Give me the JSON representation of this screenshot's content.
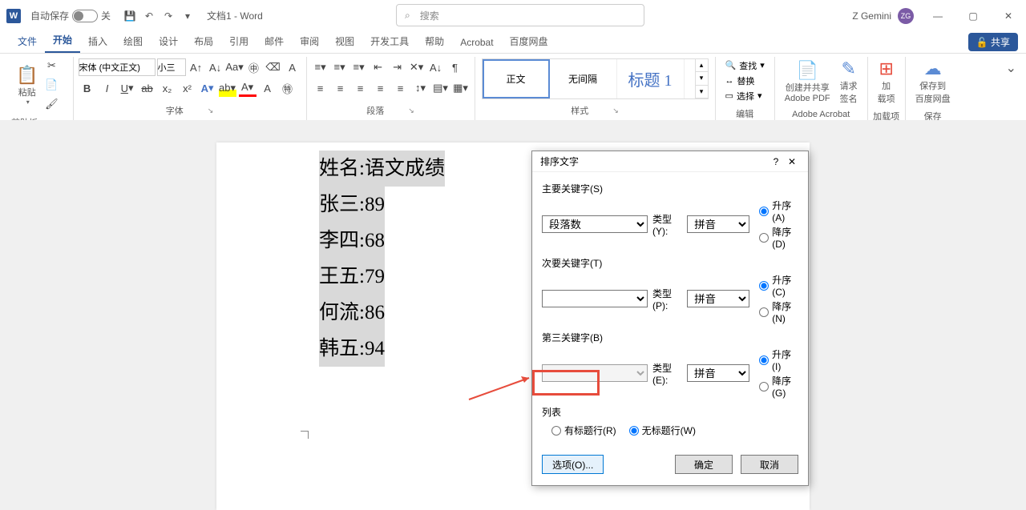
{
  "titlebar": {
    "autosave_label": "自动保存",
    "autosave_state": "关",
    "doc_title": "文档1 - Word",
    "search_placeholder": "搜索",
    "user_name": "Z Gemini",
    "user_initials": "ZG"
  },
  "tabs": {
    "file": "文件",
    "home": "开始",
    "insert": "插入",
    "draw": "绘图",
    "design": "设计",
    "layout": "布局",
    "references": "引用",
    "mailings": "邮件",
    "review": "审阅",
    "view": "视图",
    "developer": "开发工具",
    "help": "帮助",
    "acrobat": "Acrobat",
    "baidu": "百度网盘",
    "share": "共享"
  },
  "ribbon": {
    "clipboard": {
      "paste": "粘贴",
      "label": "剪贴板"
    },
    "font": {
      "name": "宋体 (中文正文)",
      "size": "小三",
      "label": "字体"
    },
    "paragraph": {
      "label": "段落"
    },
    "styles": {
      "item1": "正文",
      "item2": "无间隔",
      "item3_preview": "标题 1",
      "label": "样式"
    },
    "editing": {
      "find": "查找",
      "replace": "替换",
      "select": "选择",
      "label": "编辑"
    },
    "acrobat": {
      "create": "创建并共享",
      "create2": "Adobe PDF",
      "request": "请求",
      "sign": "签名",
      "label": "Adobe Acrobat"
    },
    "addins": {
      "add": "加",
      "items": "载项",
      "label": "加载项"
    },
    "save": {
      "save": "保存到",
      "baidu": "百度网盘",
      "label": "保存"
    }
  },
  "document": {
    "line1": "姓名:语文成绩",
    "line2": "张三:89",
    "line3": "李四:68",
    "line4": "王五:79",
    "line5": "何流:86",
    "line6": "韩五:94"
  },
  "dialog": {
    "title": "排序文字",
    "primary_key": "主要关键字(S)",
    "primary_field": "段落数",
    "type_y": "类型(Y):",
    "type_p": "类型(P):",
    "type_e": "类型(E):",
    "type_value": "拼音",
    "asc_a": "升序(A)",
    "desc_d": "降序(D)",
    "secondary_key": "次要关键字(T)",
    "asc_c": "升序(C)",
    "desc_n": "降序(N)",
    "third_key": "第三关键字(B)",
    "asc_i": "升序(I)",
    "desc_g": "降序(G)",
    "list": "列表",
    "header_row": "有标题行(R)",
    "no_header_row": "无标题行(W)",
    "options": "选项(O)...",
    "ok": "确定",
    "cancel": "取消"
  }
}
